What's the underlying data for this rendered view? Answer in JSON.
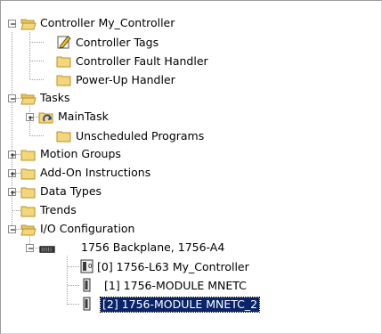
{
  "tree": {
    "controller": {
      "label": "Controller My_Controller"
    },
    "controller_tags": {
      "label": "Controller Tags"
    },
    "fault_handler": {
      "label": "Controller Fault Handler"
    },
    "powerup_handler": {
      "label": "Power-Up Handler"
    },
    "tasks": {
      "label": "Tasks"
    },
    "main_task": {
      "label": "MainTask"
    },
    "unscheduled": {
      "label": "Unscheduled Programs"
    },
    "motion_groups": {
      "label": "Motion Groups"
    },
    "addon_instructions": {
      "label": "Add-On Instructions"
    },
    "data_types": {
      "label": "Data Types"
    },
    "trends": {
      "label": "Trends"
    },
    "io_config": {
      "label": "I/O Configuration"
    },
    "backplane": {
      "label": "1756 Backplane, 1756-A4"
    },
    "slot0": {
      "label": "[0] 1756-L63 My_Controller"
    },
    "slot1": {
      "label": "[1] 1756-MODULE MNETC"
    },
    "slot2": {
      "label": "[2] 1756-MODULE MNETC_2",
      "selected": true
    }
  },
  "colors": {
    "folder": "#f3d77a",
    "folder_edge": "#b8922a",
    "selection": "#0a246a"
  }
}
